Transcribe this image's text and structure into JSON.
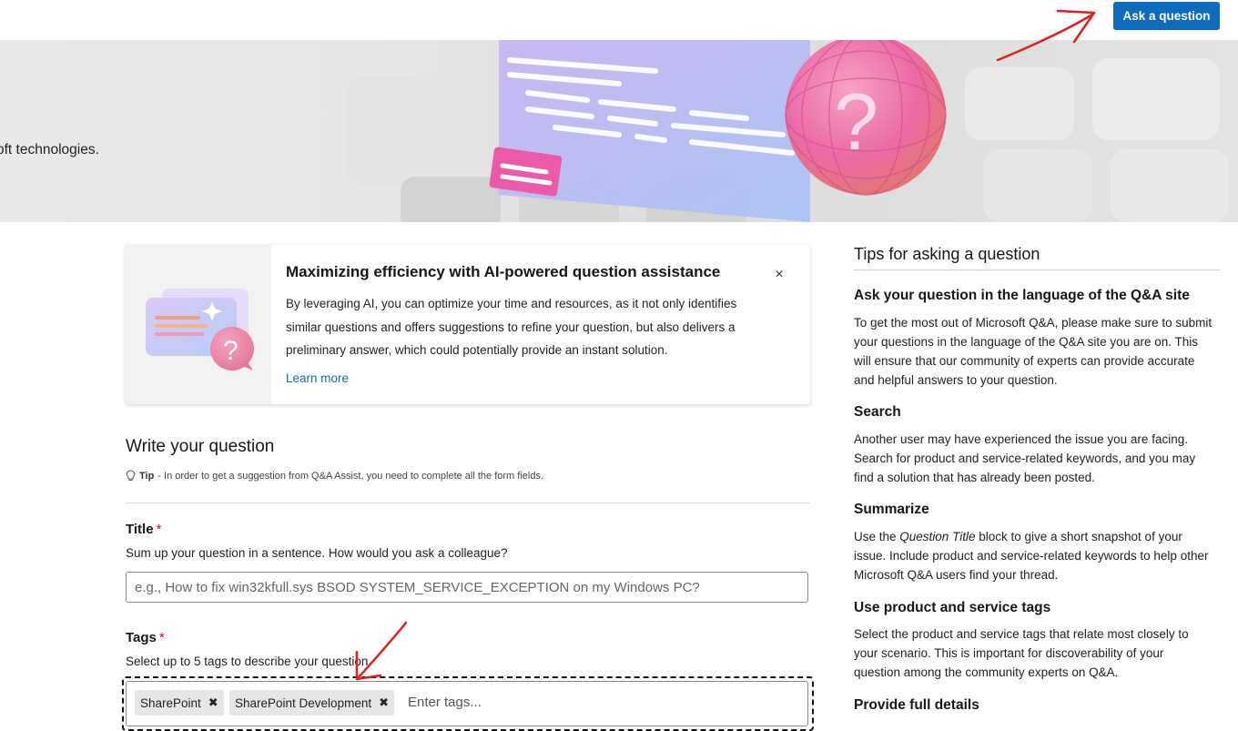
{
  "header": {
    "ask_button": "Ask a question"
  },
  "hero": {
    "text": "oft technologies."
  },
  "ai_card": {
    "title": "Maximizing efficiency with AI-powered question assistance",
    "body": "By leveraging AI, you can optimize your time and resources, as it not only identifies similar questions and offers suggestions to refine your question, but also delivers a preliminary answer, which could potentially provide an instant solution.",
    "learn_more": "Learn more",
    "close": "×"
  },
  "form": {
    "heading": "Write your question",
    "tip_label": "Tip",
    "tip_text": "- In order to get a suggestion from Q&A Assist, you need to complete all the form fields.",
    "title_label": "Title",
    "title_desc": "Sum up your question in a sentence. How would you ask a colleague?",
    "title_placeholder": "e.g., How to fix win32kfull.sys BSOD SYSTEM_SERVICE_EXCEPTION on my Windows PC?",
    "tags_label": "Tags",
    "tags_desc": "Select up to 5 tags to describe your question.",
    "required_mark": "*",
    "tags": [
      "SharePoint",
      "SharePoint Development"
    ],
    "tag_remove": "✖",
    "tags_placeholder": "Enter tags..."
  },
  "tips": {
    "title": "Tips for asking a question",
    "items": [
      {
        "heading": "Ask your question in the language of the Q&A site",
        "text": "To get the most out of Microsoft Q&A, please make sure to submit your questions in the language of the Q&A site you are on. This will ensure that our community of experts can provide accurate and helpful answers to your question."
      },
      {
        "heading": "Search",
        "text": "Another user may have experienced the issue you are facing. Search for product and service-related keywords, and you may find a solution that has already been posted."
      },
      {
        "heading": "Summarize",
        "text_before": "Use the ",
        "text_em": "Question Title",
        "text_after": " block to give a short snapshot of your issue. Include product and service-related keywords to help other Microsoft Q&A users find your thread."
      },
      {
        "heading": "Use product and service tags",
        "text": "Select the product and service tags that relate most closely to your scenario. This is important for discoverability of your question among the community experts on Q&A."
      },
      {
        "heading": "Provide full details"
      }
    ]
  },
  "colors": {
    "accent": "#0f6cbd",
    "annotation": "#e0211b",
    "required": "#c50f1f"
  }
}
